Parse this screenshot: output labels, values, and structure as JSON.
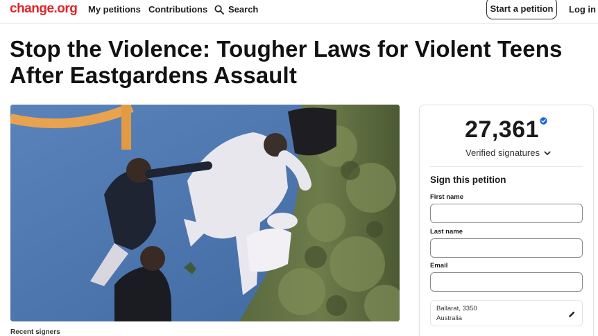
{
  "header": {
    "logo": "change.org",
    "nav": {
      "my_petitions": "My petitions",
      "contributions": "Contributions",
      "search": "Search"
    },
    "start_petition": "Start a petition",
    "login": "Log in"
  },
  "petition": {
    "title": "Stop the Violence: Tougher Laws for Violent Teens After Eastgardens Assault",
    "recent_signers_label": "Recent signers"
  },
  "signatures": {
    "count": "27,361",
    "label": "Verified signatures"
  },
  "sign_form": {
    "heading": "Sign this petition",
    "first_name_label": "First name",
    "last_name_label": "Last name",
    "email_label": "Email",
    "location_line1": "Ballarat, 3350",
    "location_line2": "Australia"
  },
  "colors": {
    "brand": "#e0242a",
    "verified_badge": "#1a66d6"
  },
  "icons": [
    "search-icon",
    "verified-badge-icon",
    "chevron-down-icon",
    "pencil-icon"
  ]
}
